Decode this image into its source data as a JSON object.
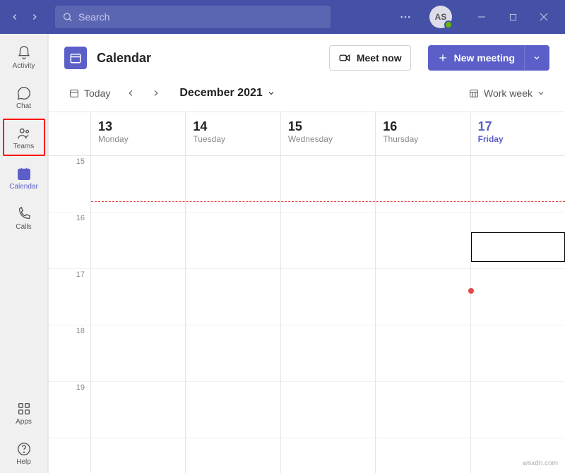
{
  "titlebar": {
    "search_placeholder": "Search",
    "avatar_initials": "AS"
  },
  "sidebar": {
    "items": [
      {
        "label": "Activity"
      },
      {
        "label": "Chat"
      },
      {
        "label": "Teams"
      },
      {
        "label": "Calendar"
      },
      {
        "label": "Calls"
      }
    ],
    "apps_label": "Apps",
    "help_label": "Help"
  },
  "header": {
    "title": "Calendar",
    "meet_now_label": "Meet now",
    "new_meeting_label": "New meeting"
  },
  "toolbar": {
    "today_label": "Today",
    "month_label": "December 2021",
    "view_label": "Work week"
  },
  "calendar": {
    "time_slots": [
      "15",
      "16",
      "17",
      "18",
      "19"
    ],
    "days": [
      {
        "num": "13",
        "name": "Monday"
      },
      {
        "num": "14",
        "name": "Tuesday"
      },
      {
        "num": "15",
        "name": "Wednesday"
      },
      {
        "num": "16",
        "name": "Thursday"
      },
      {
        "num": "17",
        "name": "Friday"
      }
    ]
  },
  "watermark": "wsxdn.com"
}
